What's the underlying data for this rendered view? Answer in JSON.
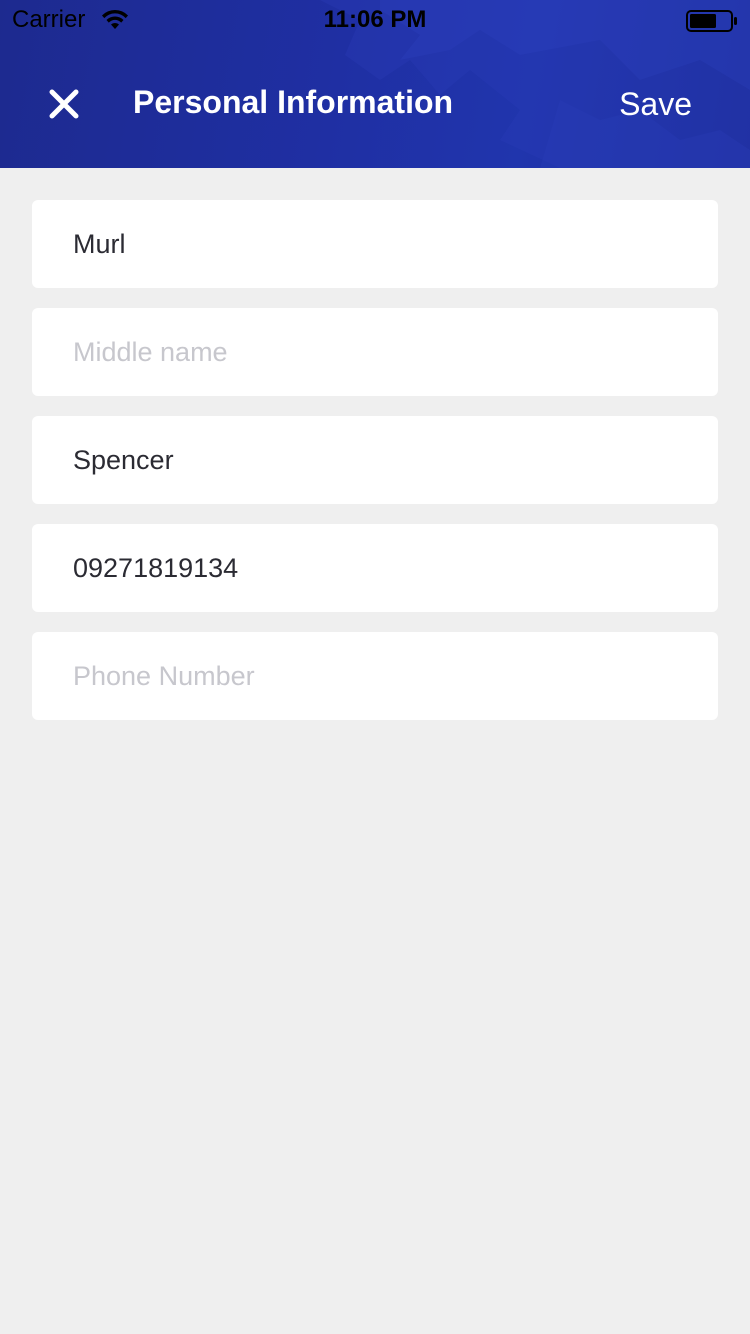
{
  "status_bar": {
    "carrier": "Carrier",
    "time": "11:06 PM",
    "wifi_icon": "wifi-icon",
    "battery_icon": "battery-icon"
  },
  "header": {
    "title": "Personal Information",
    "save_label": "Save",
    "close_icon": "close-icon",
    "background_color": "#1f2fa3"
  },
  "form": {
    "fields": [
      {
        "value": "Murl",
        "placeholder": ""
      },
      {
        "value": "",
        "placeholder": "Middle name"
      },
      {
        "value": "Spencer",
        "placeholder": ""
      },
      {
        "value": "09271819134",
        "placeholder": ""
      },
      {
        "value": "",
        "placeholder": "Phone Number"
      }
    ]
  }
}
